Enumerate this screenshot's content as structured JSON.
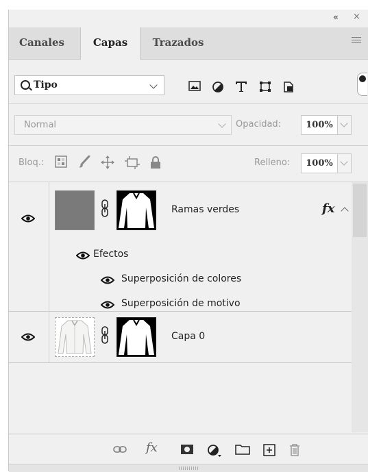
{
  "panel": {
    "collapse_glyph": "«",
    "close_glyph": "×"
  },
  "tabs": [
    {
      "label": "Canales",
      "active": false
    },
    {
      "label": "Capas",
      "active": true
    },
    {
      "label": "Trazados",
      "active": false
    }
  ],
  "filter": {
    "kind_label": "Tipo",
    "icons": [
      "image-filter-icon",
      "adjustment-filter-icon",
      "type-filter-icon",
      "shape-filter-icon",
      "smart-object-filter-icon"
    ]
  },
  "blend": {
    "mode": "Normal",
    "opacity_label": "Opacidad:",
    "opacity_value": "100%"
  },
  "lock": {
    "label": "Bloq.:",
    "icons": [
      "lock-transparent-pixels-icon",
      "lock-image-pixels-icon",
      "lock-position-icon",
      "lock-artboard-icon",
      "lock-all-icon"
    ],
    "fill_label": "Relleno:",
    "fill_value": "100%"
  },
  "layers": [
    {
      "name": "Ramas verdes",
      "visible": true,
      "fx_label": "fx",
      "effects_label": "Efectos",
      "effects": [
        "Superposición de colores",
        "Superposición de motivo"
      ]
    },
    {
      "name": "Capa 0",
      "visible": true
    }
  ],
  "bottom_bar": {
    "fx_label": "fx",
    "icons": [
      "link-layers-icon",
      "add-style-icon",
      "add-mask-icon",
      "new-adjustment-icon",
      "new-group-icon",
      "new-layer-icon",
      "delete-layer-icon"
    ]
  },
  "colors": {
    "panel_bg": "#f0f0f0",
    "tab_bar_bg": "#dedede",
    "fill_thumb": "#7a7a7a"
  }
}
